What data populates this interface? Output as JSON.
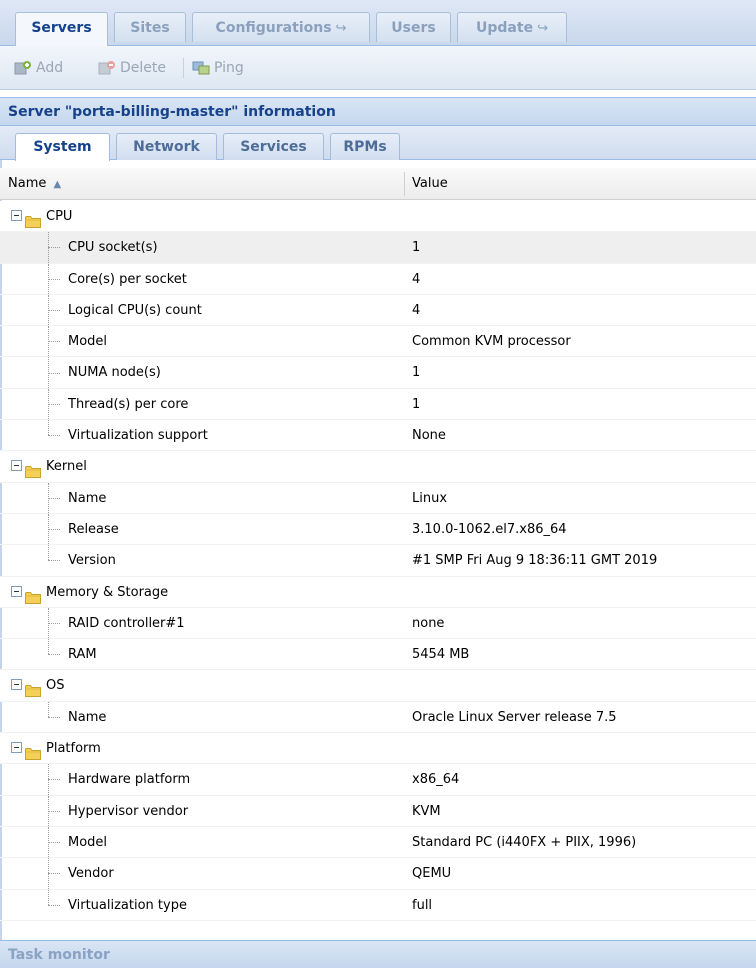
{
  "top_tabs": [
    {
      "label": "Servers",
      "arrow": ""
    },
    {
      "label": "Sites",
      "arrow": ""
    },
    {
      "label": "Configurations",
      "arrow": "↪"
    },
    {
      "label": "Users",
      "arrow": ""
    },
    {
      "label": "Update",
      "arrow": "↪"
    }
  ],
  "toolbar": {
    "add": "Add",
    "delete": "Delete",
    "ping": "Ping"
  },
  "panel_title": "Server \"porta-billing-master\" information",
  "sub_tabs": [
    "System",
    "Network",
    "Services",
    "RPMs"
  ],
  "grid": {
    "col_name": "Name",
    "sort_arrow": "▲",
    "col_value": "Value"
  },
  "groups": [
    {
      "name": "CPU",
      "items": [
        {
          "name": "CPU socket(s)",
          "value": "1"
        },
        {
          "name": "Core(s) per socket",
          "value": "4"
        },
        {
          "name": "Logical CPU(s) count",
          "value": "4"
        },
        {
          "name": "Model",
          "value": "Common KVM processor"
        },
        {
          "name": "NUMA node(s)",
          "value": "1"
        },
        {
          "name": "Thread(s) per core",
          "value": "1"
        },
        {
          "name": "Virtualization support",
          "value": "None"
        }
      ]
    },
    {
      "name": "Kernel",
      "items": [
        {
          "name": "Name",
          "value": "Linux"
        },
        {
          "name": "Release",
          "value": "3.10.0-1062.el7.x86_64"
        },
        {
          "name": "Version",
          "value": "#1 SMP Fri Aug 9 18:36:11 GMT 2019"
        }
      ]
    },
    {
      "name": "Memory & Storage",
      "items": [
        {
          "name": "RAID controller#1",
          "value": "none"
        },
        {
          "name": "RAM",
          "value": "5454 MB"
        }
      ]
    },
    {
      "name": "OS",
      "items": [
        {
          "name": "Name",
          "value": "Oracle Linux Server release 7.5"
        }
      ]
    },
    {
      "name": "Platform",
      "items": [
        {
          "name": "Hardware platform",
          "value": "x86_64"
        },
        {
          "name": "Hypervisor vendor",
          "value": "KVM"
        },
        {
          "name": "Model",
          "value": "Standard PC (i440FX + PIIX, 1996)"
        },
        {
          "name": "Vendor",
          "value": "QEMU"
        },
        {
          "name": "Virtualization type",
          "value": "full"
        }
      ]
    }
  ],
  "footer": "Task monitor",
  "colors": {
    "title_text": "#15428b",
    "accent": "#99bbe8",
    "folder": "#f2c94c"
  }
}
